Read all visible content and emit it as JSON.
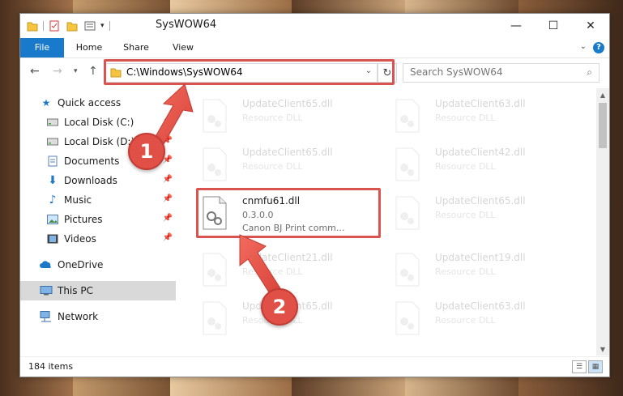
{
  "window": {
    "title": "SysWOW64"
  },
  "ribbon": {
    "tabs": [
      "File",
      "Home",
      "Share",
      "View"
    ],
    "help": "?"
  },
  "address": {
    "path": "C:\\Windows\\SysWOW64"
  },
  "search": {
    "placeholder": "Search SysWOW64"
  },
  "sidebar": {
    "items": [
      {
        "label": "Quick access"
      },
      {
        "label": "Local Disk (C:)"
      },
      {
        "label": "Local Disk (D:)"
      },
      {
        "label": "Documents"
      },
      {
        "label": "Downloads"
      },
      {
        "label": "Music"
      },
      {
        "label": "Pictures"
      },
      {
        "label": "Videos"
      },
      {
        "label": "OneDrive"
      },
      {
        "label": "This PC"
      },
      {
        "label": "Network"
      }
    ]
  },
  "files": {
    "left": [
      {
        "name": "UpdateClient65.dll",
        "sub": "Resource DLL"
      },
      {
        "name": "UpdateClient65.dll",
        "sub": "Resource DLL"
      },
      {
        "name": "cnmfu61.dll",
        "version": "0.3.0.0",
        "desc": "Canon BJ Print comm..."
      },
      {
        "name": "UpdateClient21.dll",
        "sub": "Resource DLL"
      },
      {
        "name": "UpdateClient65.dll",
        "sub": "Resource DLL"
      }
    ],
    "right": [
      {
        "name": "UpdateClient63.dll",
        "sub": "Resource DLL"
      },
      {
        "name": "UpdateClient42.dll",
        "sub": "Resource DLL"
      },
      {
        "name": "UpdateClient65.dll",
        "sub": "Resource DLL"
      },
      {
        "name": "UpdateClient19.dll",
        "sub": "Resource DLL"
      },
      {
        "name": "UpdateClient63.dll",
        "sub": "Resource DLL"
      }
    ]
  },
  "status": {
    "items": "184 items"
  },
  "annotations": {
    "step1": "1",
    "step2": "2"
  },
  "colors": {
    "accent": "#1979ca",
    "highlight": "#d9534f",
    "badge": "#e05046"
  }
}
